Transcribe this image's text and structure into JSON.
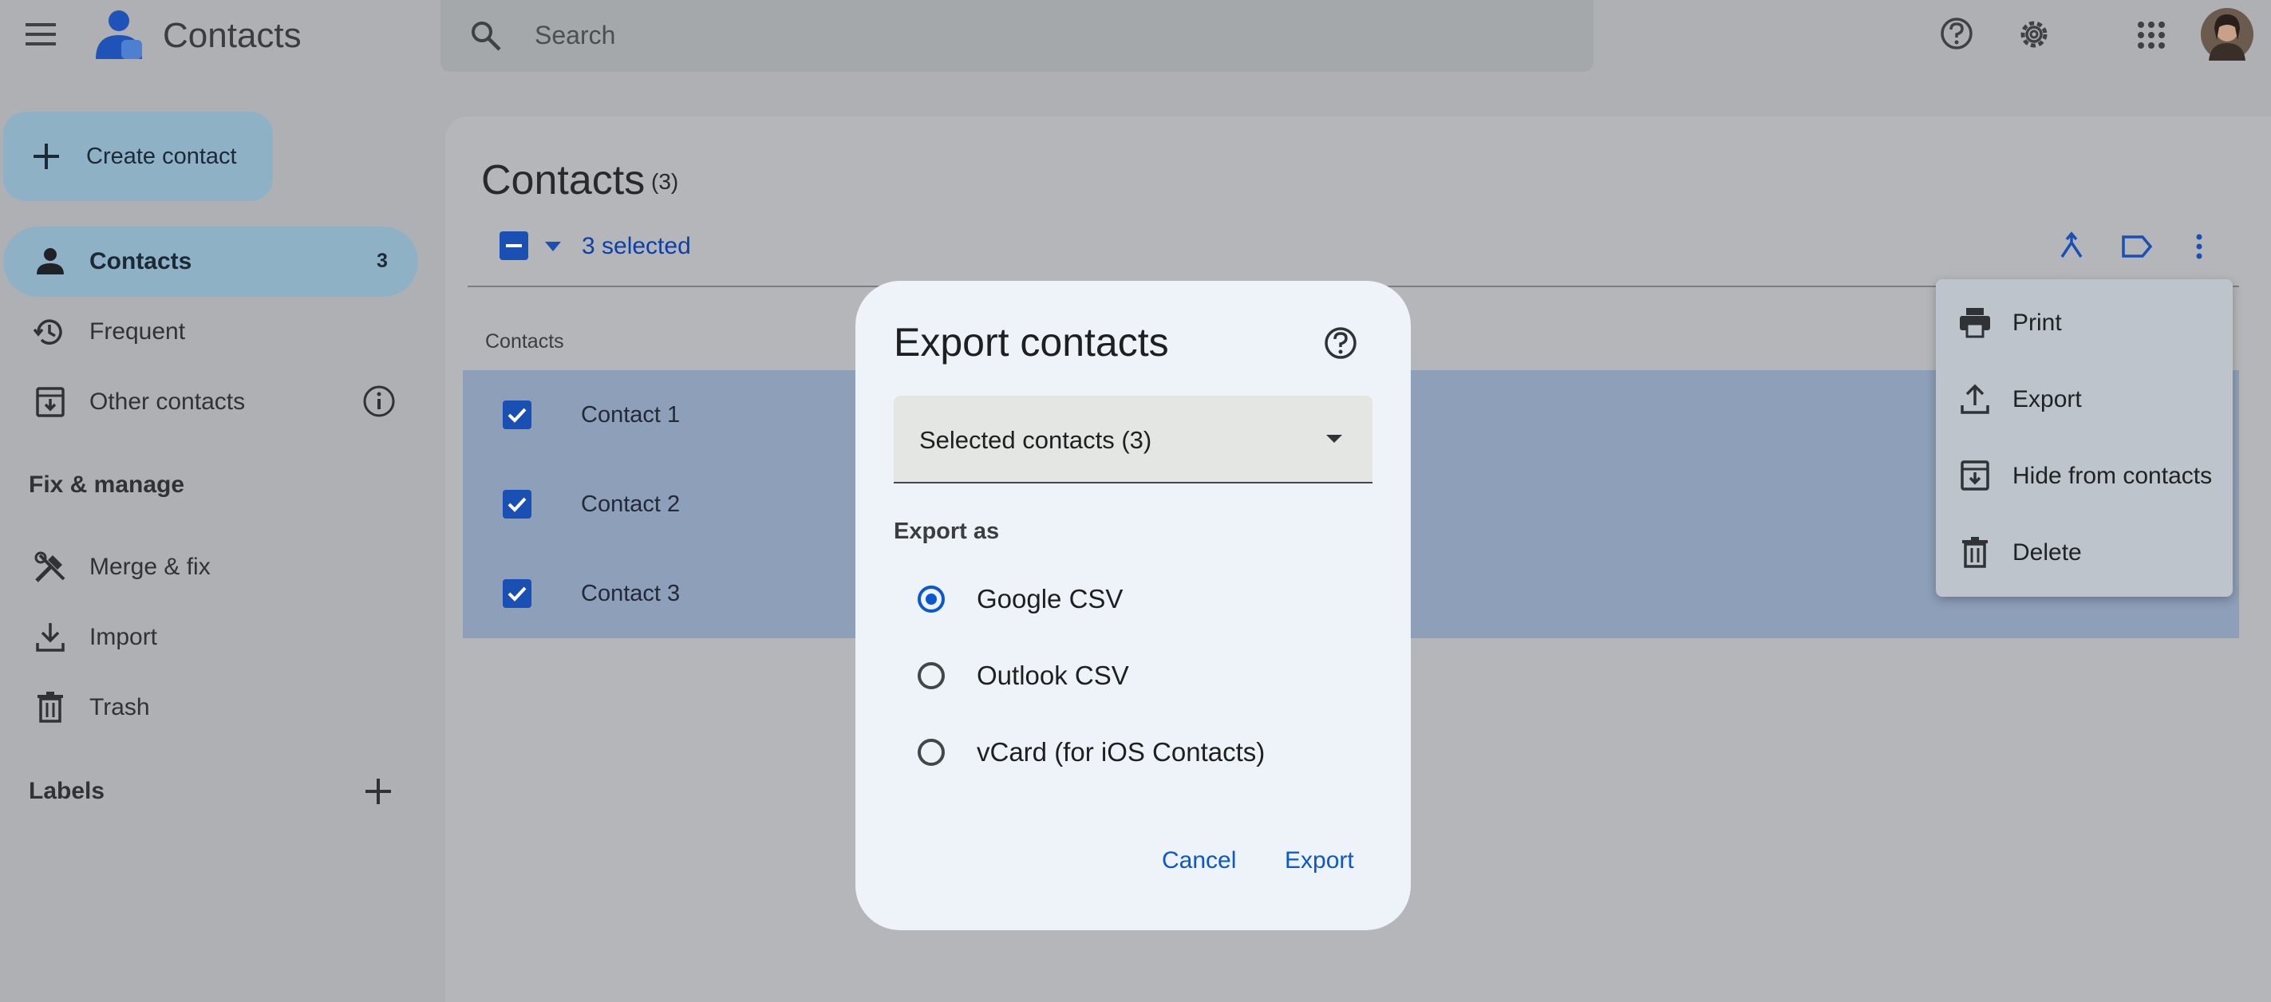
{
  "app": {
    "title": "Contacts",
    "search_placeholder": "Search",
    "accent_color": "#0b57d0"
  },
  "header_icons": [
    "main-menu-icon",
    "contacts-logo-icon",
    "search-icon",
    "help-icon",
    "settings-icon",
    "apps-grid-icon",
    "avatar"
  ],
  "sidebar": {
    "create_label": "Create contact",
    "items": [
      {
        "label": "Contacts",
        "count": "3",
        "icon": "person-icon",
        "active": true
      },
      {
        "label": "Frequent",
        "icon": "history-icon"
      },
      {
        "label": "Other contacts",
        "icon": "archive-download-icon"
      }
    ],
    "fix_manage_heading": "Fix & manage",
    "fix_items": [
      {
        "label": "Merge & fix",
        "icon": "tools-icon"
      },
      {
        "label": "Import",
        "icon": "download-icon"
      },
      {
        "label": "Trash",
        "icon": "trash-icon"
      }
    ],
    "labels_heading": "Labels"
  },
  "main": {
    "title": "Contacts",
    "count": "(3)",
    "selected_text": "3 selected",
    "column_header": "Contacts",
    "rows": [
      {
        "name": "Contact 1",
        "checked": true
      },
      {
        "name": "Contact 2",
        "checked": true
      },
      {
        "name": "Contact 3",
        "checked": true
      }
    ]
  },
  "menu": {
    "items": [
      {
        "label": "Print",
        "icon": "print-icon"
      },
      {
        "label": "Export",
        "icon": "upload-icon"
      },
      {
        "label": "Hide from contacts",
        "icon": "archive-icon"
      },
      {
        "label": "Delete",
        "icon": "trash-icon"
      }
    ]
  },
  "dialog": {
    "title": "Export contacts",
    "source_value": "Selected contacts (3)",
    "export_as_label": "Export as",
    "options": [
      {
        "label": "Google CSV",
        "selected": true
      },
      {
        "label": "Outlook CSV",
        "selected": false
      },
      {
        "label": "vCard (for iOS Contacts)",
        "selected": false
      }
    ],
    "cancel_label": "Cancel",
    "export_label": "Export"
  }
}
